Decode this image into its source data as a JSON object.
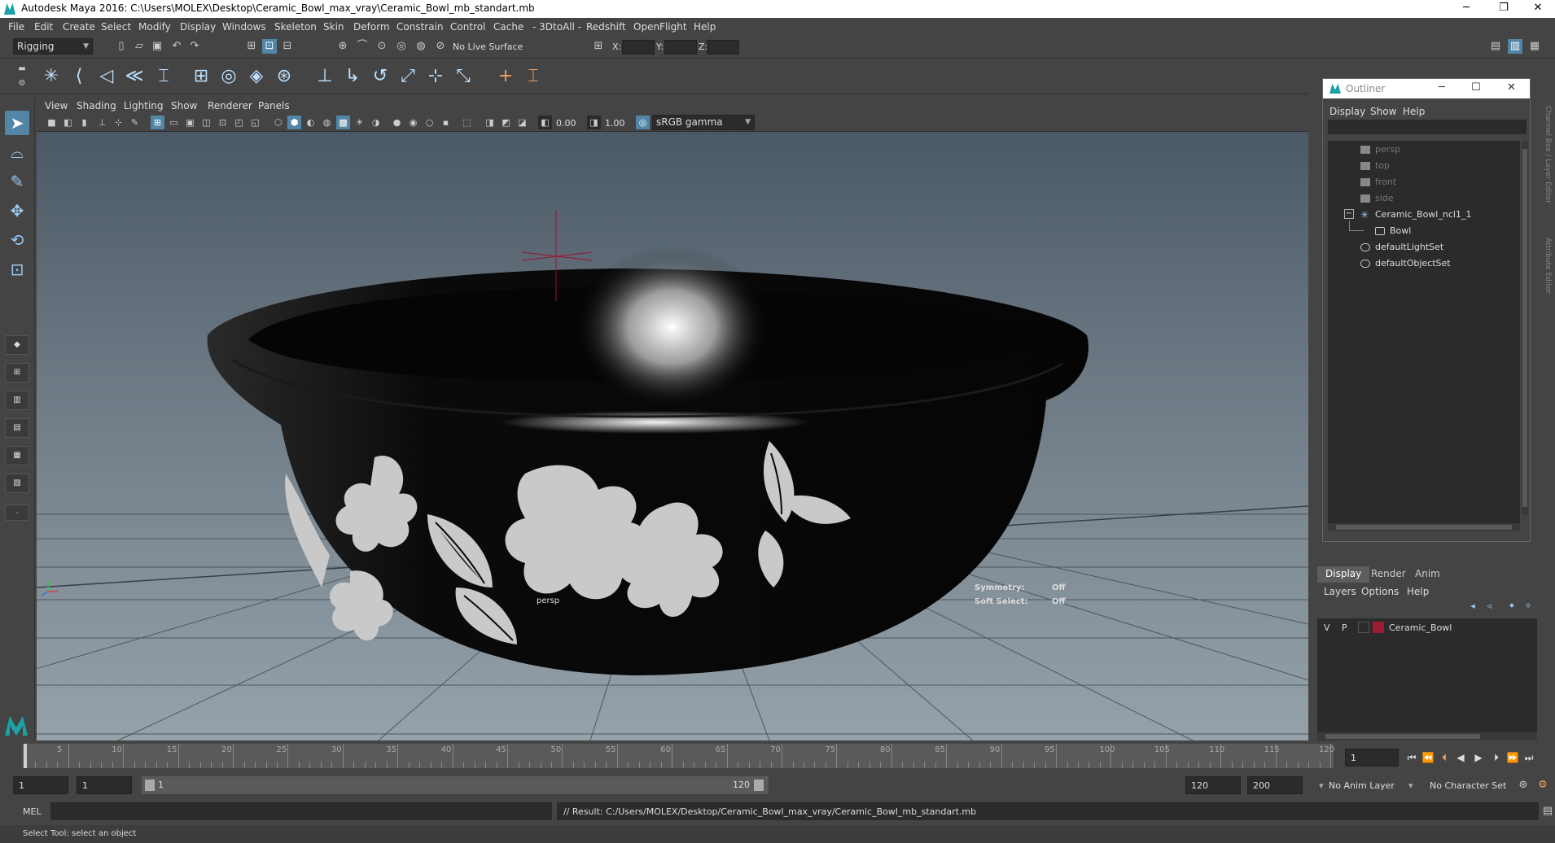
{
  "window": {
    "title": "Autodesk Maya 2016: C:\\Users\\MOLEX\\Desktop\\Ceramic_Bowl_max_vray\\Ceramic_Bowl_mb_standart.mb",
    "minimize": "─",
    "restore": "❐",
    "close": "✕"
  },
  "menubar": [
    "File",
    "Edit",
    "Create",
    "Select",
    "Modify",
    "Display",
    "Windows",
    "Skeleton",
    "Skin",
    "Deform",
    "Constrain",
    "Control",
    "Cache",
    "- 3DtoAll -",
    "Redshift",
    "OpenFlight",
    "Help"
  ],
  "statusline": {
    "mode": "Rigging",
    "live_surface": "No Live Surface",
    "x_label": "X:",
    "y_label": "Y:",
    "z_label": "Z:"
  },
  "viewport": {
    "menu": [
      "View",
      "Shading",
      "Lighting",
      "Show",
      "Renderer",
      "Panels"
    ],
    "exposure": "0.00",
    "gamma": "1.00",
    "colorspace": "sRGB gamma",
    "camera_label": "persp",
    "symmetry_label": "Symmetry:",
    "symmetry_value": "Off",
    "soft_select_label": "Soft Select:",
    "soft_select_value": "Off"
  },
  "outliner": {
    "title": "Outliner",
    "menu": [
      "Display",
      "Show",
      "Help"
    ],
    "items": [
      {
        "label": "persp",
        "type": "camera"
      },
      {
        "label": "top",
        "type": "camera"
      },
      {
        "label": "front",
        "type": "camera"
      },
      {
        "label": "side",
        "type": "camera"
      },
      {
        "label": "Ceramic_Bowl_ncl1_1",
        "type": "group"
      },
      {
        "label": "Bowl",
        "type": "mesh"
      },
      {
        "label": "defaultLightSet",
        "type": "set"
      },
      {
        "label": "defaultObjectSet",
        "type": "set"
      }
    ],
    "collapse_symbol": "−"
  },
  "side_tabs": {
    "channel": "Channel Box / Layer Editor",
    "attribute": "Attribute Editor"
  },
  "layer_editor": {
    "tabs": [
      "Display",
      "Render",
      "Anim"
    ],
    "menu": [
      "Layers",
      "Options",
      "Help"
    ],
    "layer": {
      "v": "V",
      "p": "P",
      "name": "Ceramic_Bowl",
      "color": "#9b1b30"
    }
  },
  "timeline": {
    "ticks": [
      "5",
      "10",
      "15",
      "20",
      "25",
      "30",
      "35",
      "40",
      "45",
      "50",
      "55",
      "60",
      "65",
      "70",
      "75",
      "80",
      "85",
      "90",
      "95",
      "100",
      "105",
      "110",
      "115",
      "120"
    ],
    "current_frame_marker": "1",
    "current_frame": "1"
  },
  "range": {
    "start": "1",
    "anim_start": "1",
    "slider_start": "1",
    "slider_end": "120",
    "anim_end": "120",
    "end": "200",
    "anim_layer": "No Anim Layer",
    "character_set": "No Character Set"
  },
  "command": {
    "mode": "MEL",
    "result": "// Result: C:/Users/MOLEX/Desktop/Ceramic_Bowl_max_vray/Ceramic_Bowl_mb_standart.mb"
  },
  "help_line": "Select Tool: select an object",
  "colors": {
    "accent": "#5285a6",
    "bowl": "#0a0a0a",
    "pattern": "#c9c9c9",
    "viewport_top": "#4b5966",
    "viewport_bottom": "#95a2aa"
  }
}
